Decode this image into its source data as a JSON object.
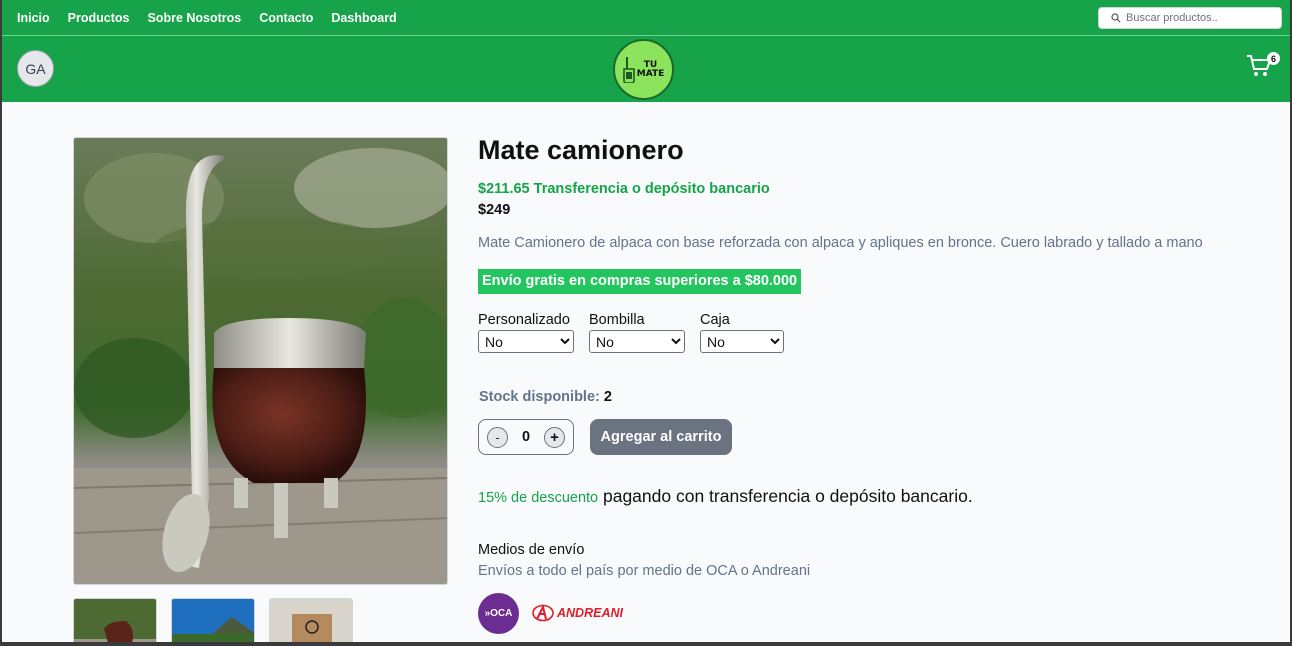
{
  "nav": {
    "links": [
      "Inicio",
      "Productos",
      "Sobre Nosotros",
      "Contacto",
      "Dashboard"
    ],
    "search_placeholder": "Buscar productos.."
  },
  "header": {
    "avatar_initials": "GA",
    "logo_line1": "TU",
    "logo_line2": "MATE",
    "cart_count": "6",
    "brand_color": "#16a34a"
  },
  "product": {
    "title": "Mate camionero",
    "price_transfer": "$211.65 Transferencia o depósito bancario",
    "price": "$249",
    "description": "Mate Camionero de alpaca con base reforzada con alpaca y apliques en bronce. Cuero labrado y tallado a mano",
    "shipping_banner": "Envío gratis en compras superiores a $80.000",
    "options": [
      {
        "label": "Personalizado",
        "value": "No"
      },
      {
        "label": "Bombilla",
        "value": "No"
      },
      {
        "label": "Caja",
        "value": "No"
      }
    ],
    "stock_label": "Stock disponible:",
    "stock_value": "2",
    "quantity": "0",
    "minus": "-",
    "plus": "+",
    "add_to_cart": "Agregar al carrito",
    "discount_pct": "15% de descuento",
    "discount_rest": " pagando con transferencia o depósito bancario.",
    "shipping_title": "Medios de envío",
    "shipping_subtitle": "Envíos a todo el país por medio de OCA o Andreani",
    "carrier_oca": "»OCA",
    "carrier_andreani": "ANDREANI"
  }
}
